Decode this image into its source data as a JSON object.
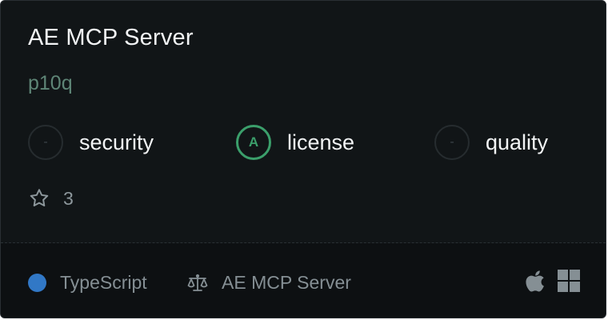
{
  "server": {
    "name": "AE MCP Server",
    "author": "p10q"
  },
  "scores": [
    {
      "grade": "-",
      "label": "security"
    },
    {
      "grade": "A",
      "label": "license"
    },
    {
      "grade": "-",
      "label": "quality"
    }
  ],
  "stars": {
    "count": "3",
    "icon": "star-outline-icon"
  },
  "footer": {
    "language": "TypeScript",
    "language_color": "#3178c6",
    "license_name": "AE MCP Server",
    "license_icon": "scale-icon",
    "platforms": [
      "apple-icon",
      "windows-icon"
    ]
  },
  "colors": {
    "grade_a": "#3b9f6b",
    "background": "#111517",
    "footer_background": "#0d1012"
  }
}
